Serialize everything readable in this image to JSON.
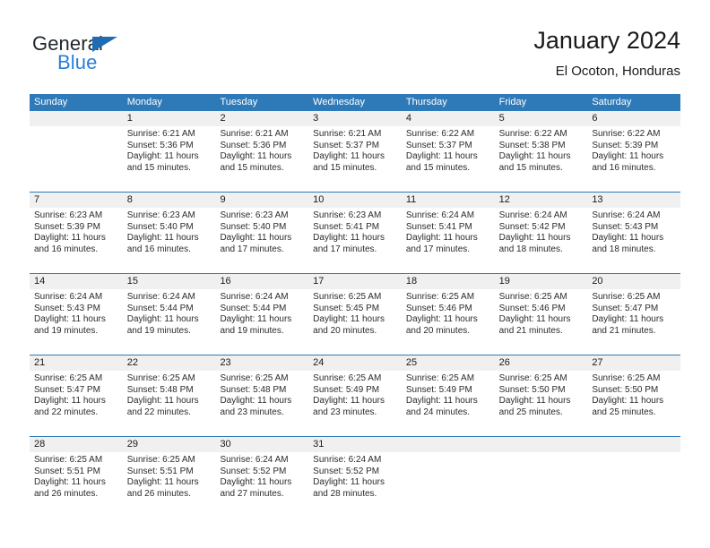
{
  "logo": {
    "word_one": "General",
    "word_two": "Blue",
    "triangle_color": "#1f6cb5",
    "blue_text_color": "#2a7fd4"
  },
  "header": {
    "title": "January 2024",
    "subtitle": "El Ocoton, Honduras"
  },
  "theme": {
    "header_blue": "#2e7ab8",
    "daynum_band": "#f0f0f0",
    "text": "#1a1a1a"
  },
  "weekdays": [
    "Sunday",
    "Monday",
    "Tuesday",
    "Wednesday",
    "Thursday",
    "Friday",
    "Saturday"
  ],
  "labels": {
    "sunrise_prefix": "Sunrise:",
    "sunset_prefix": "Sunset:",
    "daylight_prefix": "Daylight:"
  },
  "weeks": [
    [
      {
        "day": "",
        "sunrise": "",
        "sunset": "",
        "daylight": ""
      },
      {
        "day": "1",
        "sunrise": "Sunrise: 6:21 AM",
        "sunset": "Sunset: 5:36 PM",
        "daylight": "Daylight: 11 hours and 15 minutes."
      },
      {
        "day": "2",
        "sunrise": "Sunrise: 6:21 AM",
        "sunset": "Sunset: 5:36 PM",
        "daylight": "Daylight: 11 hours and 15 minutes."
      },
      {
        "day": "3",
        "sunrise": "Sunrise: 6:21 AM",
        "sunset": "Sunset: 5:37 PM",
        "daylight": "Daylight: 11 hours and 15 minutes."
      },
      {
        "day": "4",
        "sunrise": "Sunrise: 6:22 AM",
        "sunset": "Sunset: 5:37 PM",
        "daylight": "Daylight: 11 hours and 15 minutes."
      },
      {
        "day": "5",
        "sunrise": "Sunrise: 6:22 AM",
        "sunset": "Sunset: 5:38 PM",
        "daylight": "Daylight: 11 hours and 15 minutes."
      },
      {
        "day": "6",
        "sunrise": "Sunrise: 6:22 AM",
        "sunset": "Sunset: 5:39 PM",
        "daylight": "Daylight: 11 hours and 16 minutes."
      }
    ],
    [
      {
        "day": "7",
        "sunrise": "Sunrise: 6:23 AM",
        "sunset": "Sunset: 5:39 PM",
        "daylight": "Daylight: 11 hours and 16 minutes."
      },
      {
        "day": "8",
        "sunrise": "Sunrise: 6:23 AM",
        "sunset": "Sunset: 5:40 PM",
        "daylight": "Daylight: 11 hours and 16 minutes."
      },
      {
        "day": "9",
        "sunrise": "Sunrise: 6:23 AM",
        "sunset": "Sunset: 5:40 PM",
        "daylight": "Daylight: 11 hours and 17 minutes."
      },
      {
        "day": "10",
        "sunrise": "Sunrise: 6:23 AM",
        "sunset": "Sunset: 5:41 PM",
        "daylight": "Daylight: 11 hours and 17 minutes."
      },
      {
        "day": "11",
        "sunrise": "Sunrise: 6:24 AM",
        "sunset": "Sunset: 5:41 PM",
        "daylight": "Daylight: 11 hours and 17 minutes."
      },
      {
        "day": "12",
        "sunrise": "Sunrise: 6:24 AM",
        "sunset": "Sunset: 5:42 PM",
        "daylight": "Daylight: 11 hours and 18 minutes."
      },
      {
        "day": "13",
        "sunrise": "Sunrise: 6:24 AM",
        "sunset": "Sunset: 5:43 PM",
        "daylight": "Daylight: 11 hours and 18 minutes."
      }
    ],
    [
      {
        "day": "14",
        "sunrise": "Sunrise: 6:24 AM",
        "sunset": "Sunset: 5:43 PM",
        "daylight": "Daylight: 11 hours and 19 minutes."
      },
      {
        "day": "15",
        "sunrise": "Sunrise: 6:24 AM",
        "sunset": "Sunset: 5:44 PM",
        "daylight": "Daylight: 11 hours and 19 minutes."
      },
      {
        "day": "16",
        "sunrise": "Sunrise: 6:24 AM",
        "sunset": "Sunset: 5:44 PM",
        "daylight": "Daylight: 11 hours and 19 minutes."
      },
      {
        "day": "17",
        "sunrise": "Sunrise: 6:25 AM",
        "sunset": "Sunset: 5:45 PM",
        "daylight": "Daylight: 11 hours and 20 minutes."
      },
      {
        "day": "18",
        "sunrise": "Sunrise: 6:25 AM",
        "sunset": "Sunset: 5:46 PM",
        "daylight": "Daylight: 11 hours and 20 minutes."
      },
      {
        "day": "19",
        "sunrise": "Sunrise: 6:25 AM",
        "sunset": "Sunset: 5:46 PM",
        "daylight": "Daylight: 11 hours and 21 minutes."
      },
      {
        "day": "20",
        "sunrise": "Sunrise: 6:25 AM",
        "sunset": "Sunset: 5:47 PM",
        "daylight": "Daylight: 11 hours and 21 minutes."
      }
    ],
    [
      {
        "day": "21",
        "sunrise": "Sunrise: 6:25 AM",
        "sunset": "Sunset: 5:47 PM",
        "daylight": "Daylight: 11 hours and 22 minutes."
      },
      {
        "day": "22",
        "sunrise": "Sunrise: 6:25 AM",
        "sunset": "Sunset: 5:48 PM",
        "daylight": "Daylight: 11 hours and 22 minutes."
      },
      {
        "day": "23",
        "sunrise": "Sunrise: 6:25 AM",
        "sunset": "Sunset: 5:48 PM",
        "daylight": "Daylight: 11 hours and 23 minutes."
      },
      {
        "day": "24",
        "sunrise": "Sunrise: 6:25 AM",
        "sunset": "Sunset: 5:49 PM",
        "daylight": "Daylight: 11 hours and 23 minutes."
      },
      {
        "day": "25",
        "sunrise": "Sunrise: 6:25 AM",
        "sunset": "Sunset: 5:49 PM",
        "daylight": "Daylight: 11 hours and 24 minutes."
      },
      {
        "day": "26",
        "sunrise": "Sunrise: 6:25 AM",
        "sunset": "Sunset: 5:50 PM",
        "daylight": "Daylight: 11 hours and 25 minutes."
      },
      {
        "day": "27",
        "sunrise": "Sunrise: 6:25 AM",
        "sunset": "Sunset: 5:50 PM",
        "daylight": "Daylight: 11 hours and 25 minutes."
      }
    ],
    [
      {
        "day": "28",
        "sunrise": "Sunrise: 6:25 AM",
        "sunset": "Sunset: 5:51 PM",
        "daylight": "Daylight: 11 hours and 26 minutes."
      },
      {
        "day": "29",
        "sunrise": "Sunrise: 6:25 AM",
        "sunset": "Sunset: 5:51 PM",
        "daylight": "Daylight: 11 hours and 26 minutes."
      },
      {
        "day": "30",
        "sunrise": "Sunrise: 6:24 AM",
        "sunset": "Sunset: 5:52 PM",
        "daylight": "Daylight: 11 hours and 27 minutes."
      },
      {
        "day": "31",
        "sunrise": "Sunrise: 6:24 AM",
        "sunset": "Sunset: 5:52 PM",
        "daylight": "Daylight: 11 hours and 28 minutes."
      },
      {
        "day": "",
        "sunrise": "",
        "sunset": "",
        "daylight": ""
      },
      {
        "day": "",
        "sunrise": "",
        "sunset": "",
        "daylight": ""
      },
      {
        "day": "",
        "sunrise": "",
        "sunset": "",
        "daylight": ""
      }
    ]
  ]
}
